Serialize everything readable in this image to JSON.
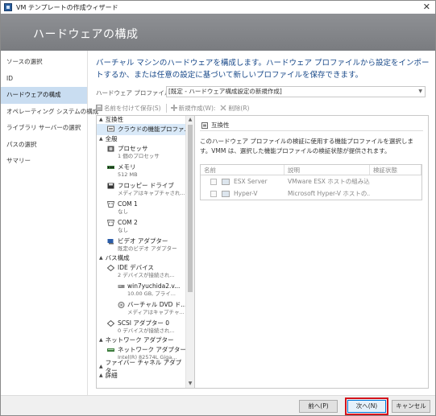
{
  "window": {
    "title": "VM テンプレートの作成ウィザード",
    "close_glyph": "✕"
  },
  "header": {
    "title": "ハードウェアの構成"
  },
  "nav": {
    "items": [
      {
        "label": "ソースの選択"
      },
      {
        "label": "ID"
      },
      {
        "label": "ハードウェアの構成"
      },
      {
        "label": "オペレーティング システムの構成"
      },
      {
        "label": "ライブラリ サーバーの選択"
      },
      {
        "label": "パスの選択"
      },
      {
        "label": "サマリー"
      }
    ],
    "active_index": 2
  },
  "main": {
    "description": "バーチャル マシンのハードウェアを構成します。ハードウェア プロファイルから設定をインポートするか、または任意の設定に基づいて新しいプロファイルを保存できます。",
    "profile_label": "ハードウェア プロファイル(H):",
    "profile_value": "[既定 - ハードウェア構成設定の新規作成]",
    "toolbar": {
      "save_as": "名前を付けて保存(S)",
      "new": "新規作成(W):",
      "delete": "削除(R)"
    }
  },
  "tree": {
    "categories": [
      {
        "label": "互換性",
        "items": [
          {
            "name": "クラウドの機能プロファ...",
            "sub": "",
            "icon": "cloud-icon",
            "selected": true
          }
        ]
      },
      {
        "label": "全般",
        "items": [
          {
            "name": "プロセッサ",
            "sub": "1 個のプロセッサ",
            "icon": "processor-icon"
          },
          {
            "name": "メモリ",
            "sub": "512 MB",
            "icon": "memory-icon"
          },
          {
            "name": "フロッピー ドライブ",
            "sub": "メディアはキャプチャされ...",
            "icon": "floppy-icon"
          },
          {
            "name": "COM 1",
            "sub": "なし",
            "icon": "com-port-icon"
          },
          {
            "name": "COM 2",
            "sub": "なし",
            "icon": "com-port-icon"
          },
          {
            "name": "ビデオ アダプター",
            "sub": "既定のビデオ アダプター",
            "icon": "video-adapter-icon"
          }
        ]
      },
      {
        "label": "バス構成",
        "items": [
          {
            "name": "IDE デバイス",
            "sub": "2 デバイスが接続され...",
            "icon": "ide-icon"
          },
          {
            "name": "win7yuchida2.v...",
            "sub": "10.00 GB, プライ...",
            "icon": "disk-icon",
            "indent": true
          },
          {
            "name": "バーチャル DVD ド...",
            "sub": "メディアはキャプチャ...",
            "icon": "dvd-icon",
            "indent": true
          },
          {
            "name": "SCSI アダプター 0",
            "sub": "0 デバイスが接続され...",
            "icon": "scsi-icon"
          }
        ]
      },
      {
        "label": "ネットワーク アダプター",
        "items": [
          {
            "name": "ネットワーク アダプター 1",
            "sub": "Intel(R) 82574L Giga...",
            "icon": "network-adapter-icon"
          }
        ]
      },
      {
        "label": "ファイバー チャネル アダプター",
        "items": []
      },
      {
        "label": "詳細",
        "items": []
      }
    ]
  },
  "pane": {
    "header": "互換性",
    "text": "このハードウェア プロファイルの検証に使用する機能プロファイルを選択します。VMM は、選択した機能プロファイルの検証状態が提供されます。",
    "columns": [
      "名前",
      "説明",
      "検証状態"
    ],
    "rows": [
      {
        "name": "ESX Server",
        "desc": "VMware ESX ホストの組み込...",
        "status": ""
      },
      {
        "name": "Hyper-V",
        "desc": "Microsoft Hyper-V ホストの...",
        "status": ""
      }
    ]
  },
  "footer": {
    "prev": "前へ(P)",
    "next": "次へ(N)",
    "cancel": "キャンセル"
  },
  "colors": {
    "header_bg": "#7a7c80",
    "nav_active": "#c9ddf1",
    "desc_text": "#1a4a8a",
    "highlight": "#d4141c"
  }
}
